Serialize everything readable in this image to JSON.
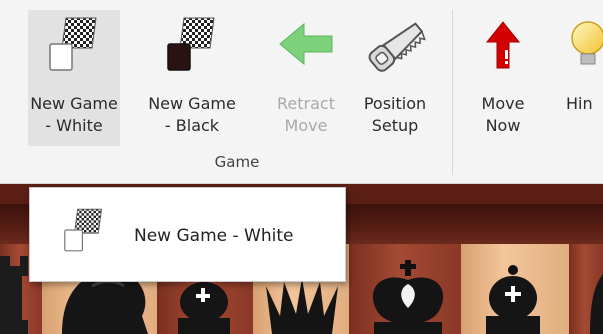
{
  "ribbon": {
    "buttons": [
      {
        "id": "new-game-white",
        "line1": "New Game",
        "line2": "- White",
        "state": "selected"
      },
      {
        "id": "new-game-black",
        "line1": "New Game",
        "line2": "- Black",
        "state": "normal"
      },
      {
        "id": "retract-move",
        "line1": "Retract",
        "line2": "Move",
        "state": "disabled"
      },
      {
        "id": "position-setup",
        "line1": "Position",
        "line2": "Setup",
        "state": "normal"
      },
      {
        "id": "move-now",
        "line1": "Move",
        "line2": "Now",
        "state": "normal"
      },
      {
        "id": "hint",
        "line1": "Hin",
        "line2": "",
        "state": "normal"
      }
    ],
    "group_label": "Game"
  },
  "tooltip": {
    "text": "New Game - White"
  },
  "icons": {
    "new_game_white": "chessboard-white-piece-icon",
    "new_game_black": "chessboard-black-piece-icon",
    "retract_move": "green-left-arrow-icon",
    "position_setup": "saw-icon",
    "move_now": "red-up-arrow-icon",
    "hint": "lightbulb-icon"
  },
  "colors": {
    "arrow_green": "#7cd27a",
    "arrow_red": "#d40000",
    "selected_bg": "#e2e2e2",
    "disabled_text": "#a9a9a9"
  }
}
